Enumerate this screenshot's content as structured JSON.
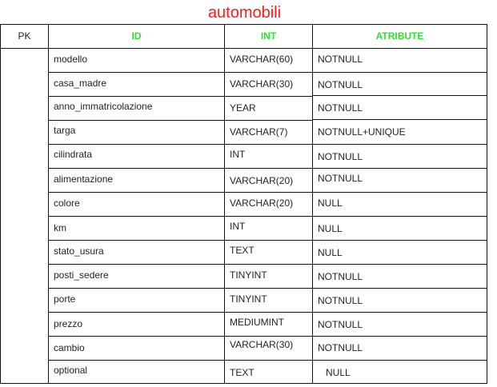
{
  "title": "automobili",
  "colors": {
    "title": "#ff1a1a",
    "header_accent": "#33dd33",
    "border": "#111111",
    "text": "#222222"
  },
  "headers": {
    "pk": "PK",
    "id": "ID",
    "int": "INT",
    "attribute": "ATRIBUTE"
  },
  "rows": [
    {
      "name": "modello",
      "type": "VARCHAR(60)",
      "attribute": "NOTNULL"
    },
    {
      "name": "casa_madre",
      "type": "VARCHAR(30)",
      "attribute": "NOTNULL"
    },
    {
      "name": "anno_immatricolazione",
      "type": "YEAR",
      "attribute": "NOTNULL"
    },
    {
      "name": "targa",
      "type": "VARCHAR(7)",
      "attribute": "NOTNULL+UNIQUE"
    },
    {
      "name": "cilindrata",
      "type": "INT",
      "attribute": "NOTNULL"
    },
    {
      "name": "alimentazione",
      "type": "VARCHAR(20)",
      "attribute": "NOTNULL"
    },
    {
      "name": "colore",
      "type": "VARCHAR(20)",
      "attribute": "NULL"
    },
    {
      "name": "km",
      "type": "INT",
      "attribute": "NULL"
    },
    {
      "name": "stato_usura",
      "type": "TEXT",
      "attribute": "NULL"
    },
    {
      "name": "posti_sedere",
      "type": "TINYINT",
      "attribute": "NOTNULL"
    },
    {
      "name": "porte",
      "type": "TINYINT",
      "attribute": "NOTNULL"
    },
    {
      "name": "prezzo",
      "type": "MEDIUMINT",
      "attribute": "NOTNULL"
    },
    {
      "name": "cambio",
      "type": "VARCHAR(30)",
      "attribute": "NOTNULL"
    },
    {
      "name": "optional",
      "type": "TEXT",
      "attribute": "NULL"
    }
  ]
}
